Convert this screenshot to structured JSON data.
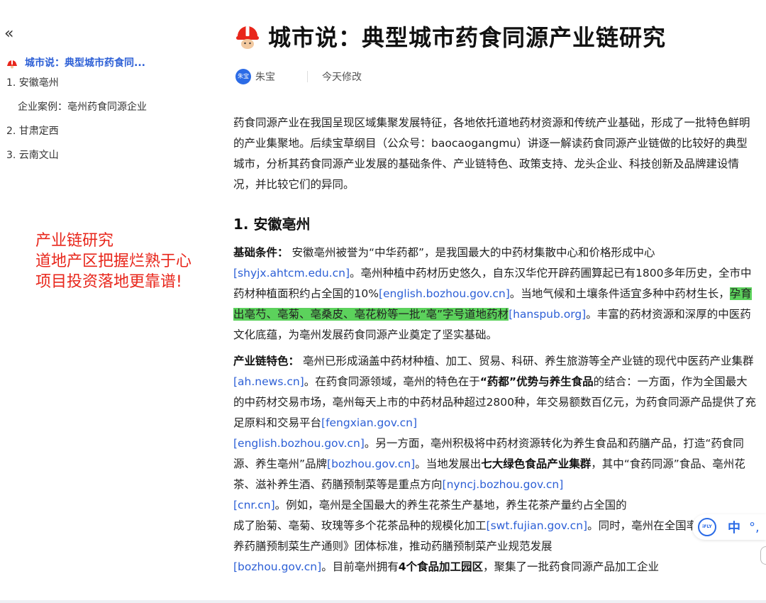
{
  "sidebar": {
    "collapse_label": "«",
    "toc": [
      {
        "label": "城市说：典型城市药食同...",
        "active": true,
        "icon": "hard-hat-icon"
      },
      {
        "label": "1. 安徽亳州"
      },
      {
        "label": "企业案例：亳州药食同源企业",
        "sub": true
      },
      {
        "label": "2. 甘肃定西"
      },
      {
        "label": "3. 云南文山"
      }
    ]
  },
  "promo": {
    "line1": "产业链研究",
    "line2": "道地产区把握烂熟于心",
    "line3": "项目投资落地更靠谱!"
  },
  "header": {
    "title": "城市说：典型城市药食同源产业链研究",
    "title_icon": "hard-hat-icon"
  },
  "meta": {
    "avatar_text": "朱宝",
    "author": "朱宝",
    "modified": "今天修改"
  },
  "article": {
    "intro": "药食同源产业在我国呈现区域集聚发展特征，各地依托道地药材资源和传统产业基础，形成了一批特色鲜明的产业集聚地。后续宝草纲目（公众号：baocaogangmu）讲逐一解读药食同源产业链做的比较好的典型城市，分析其药食同源产业发展的基础条件、产业链特色、政策支持、龙头企业、科技创新及品牌建设情况，并比较它们的异同。",
    "section1_heading": "1. 安徽亳州",
    "basic_label": "基础条件：",
    "basic_t1": " 安徽亳州被誉为“中华药都”，是我国最大的中药材集散中心和价格形成中心",
    "basic_c1": "[shyjx.ahtcm.edu.cn]",
    "basic_t2": "。亳州种植中药材历史悠久，自东汉华佗开辟药圃算起已有1800多年历史，全市中药材种植面积约占全国的10%",
    "basic_c2": "[english.bozhou.gov.cn]",
    "basic_t3": "。当地气候和土壤条件适宜多种中药材生长，",
    "basic_hl": "孕育出亳芍、亳菊、亳桑皮、亳花粉等一批“亳”字号道地药材",
    "basic_c3": "[hanspub.org]",
    "basic_t4": "。丰富的药材资源和深厚的中医药文化底蕴，为亳州发展药食同源产业奠定了坚实基础。",
    "chain_label": "产业链特色：",
    "chain_t1": " 亳州已形成涵盖中药材种植、加工、贸易、科研、养生旅游等全产业链的现代中医药产业集群",
    "chain_c1": "[ah.news.cn]",
    "chain_t2": "。在药食同源领域，亳州的特色在于",
    "chain_b1": "“药都”优势与养生食品",
    "chain_t3": "的结合：一方面，作为全国最大的中药材交易市场，亳州每天上市的中药材品种超过2800种，年交易额数百亿元，为药食同源产品提供了充足原料和交易平台",
    "chain_c2": "[fengxian.gov.cn]",
    "chain_c3": "[english.bozhou.gov.cn]",
    "chain_t4": "。另一方面，亳州积极将中药材资源转化为养生食品和药膳产品，打造“药食同源、养生亳州”品牌",
    "chain_c4": "[bozhou.gov.cn]",
    "chain_t5": "。当地发展出",
    "chain_b2": "七大绿色食品产业集群",
    "chain_t6": "，其中“食药同源”食品、亳州花茶、滋补养生酒、药膳预制菜等是重点方向",
    "chain_c5": "[nyncj.bozhou.gov.cn]",
    "chain_c6": "[cnr.cn]",
    "chain_t7": "。例如，亳州是全国最大的养生花茶生产基地，养生花茶产量约占全国的",
    "chain_t8": "成了胎菊、亳菊、玫瑰等多个花茶品种的规模化加工",
    "chain_c7": "[swt.fujian.gov.cn]",
    "chain_t9": "。同时，亳州在全国率先发布《食养药膳预制菜生产通则》团体标准，推动药膳预制菜产业规范发展",
    "chain_c8": "[bozhou.gov.cn]",
    "chain_t10": "。目前亳州拥有",
    "chain_b3": "4个食品加工园区",
    "chain_t11": "，聚集了一批药食同源产品加工企业"
  },
  "ifly": {
    "logo_text": "iFLY",
    "lang": "中",
    "dots": "°,"
  }
}
